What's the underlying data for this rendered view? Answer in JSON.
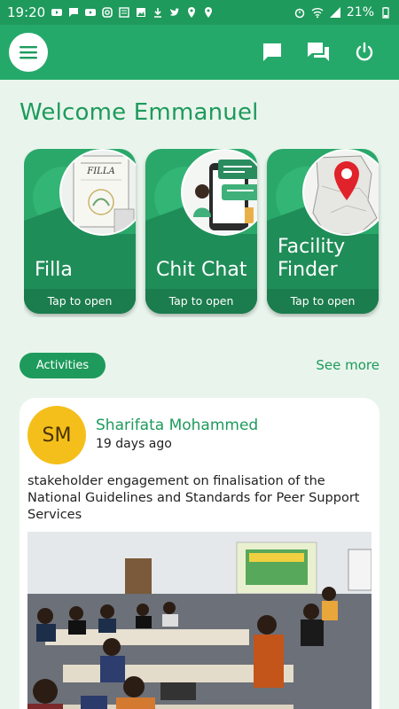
{
  "status_bar": {
    "time": "19:20",
    "battery": "21%"
  },
  "app_bar": {
    "menu_icon": "hamburger-menu-icon",
    "actions": [
      "chat-bubble-icon",
      "messages-icon",
      "power-icon"
    ]
  },
  "welcome": {
    "text": "Welcome Emmanuel"
  },
  "cards": [
    {
      "title": "Filla",
      "tap": "Tap to open",
      "thumb_label": "FILLA"
    },
    {
      "title": "Chit Chat",
      "tap": "Tap to open"
    },
    {
      "title": "Facility Finder",
      "tap": "Tap to open"
    }
  ],
  "activities": {
    "label": "Activities",
    "see_more": "See more"
  },
  "post": {
    "initials": "SM",
    "author": "Sharifata Mohammed",
    "time": "19 days ago",
    "text": "stakeholder engagement on finalisation of the National Guidelines and Standards for Peer Support Services"
  },
  "colors": {
    "primary": "#25a96a",
    "dark": "#1e9a5c",
    "avatar": "#f5bf1b",
    "background": "#e9f5ec"
  }
}
